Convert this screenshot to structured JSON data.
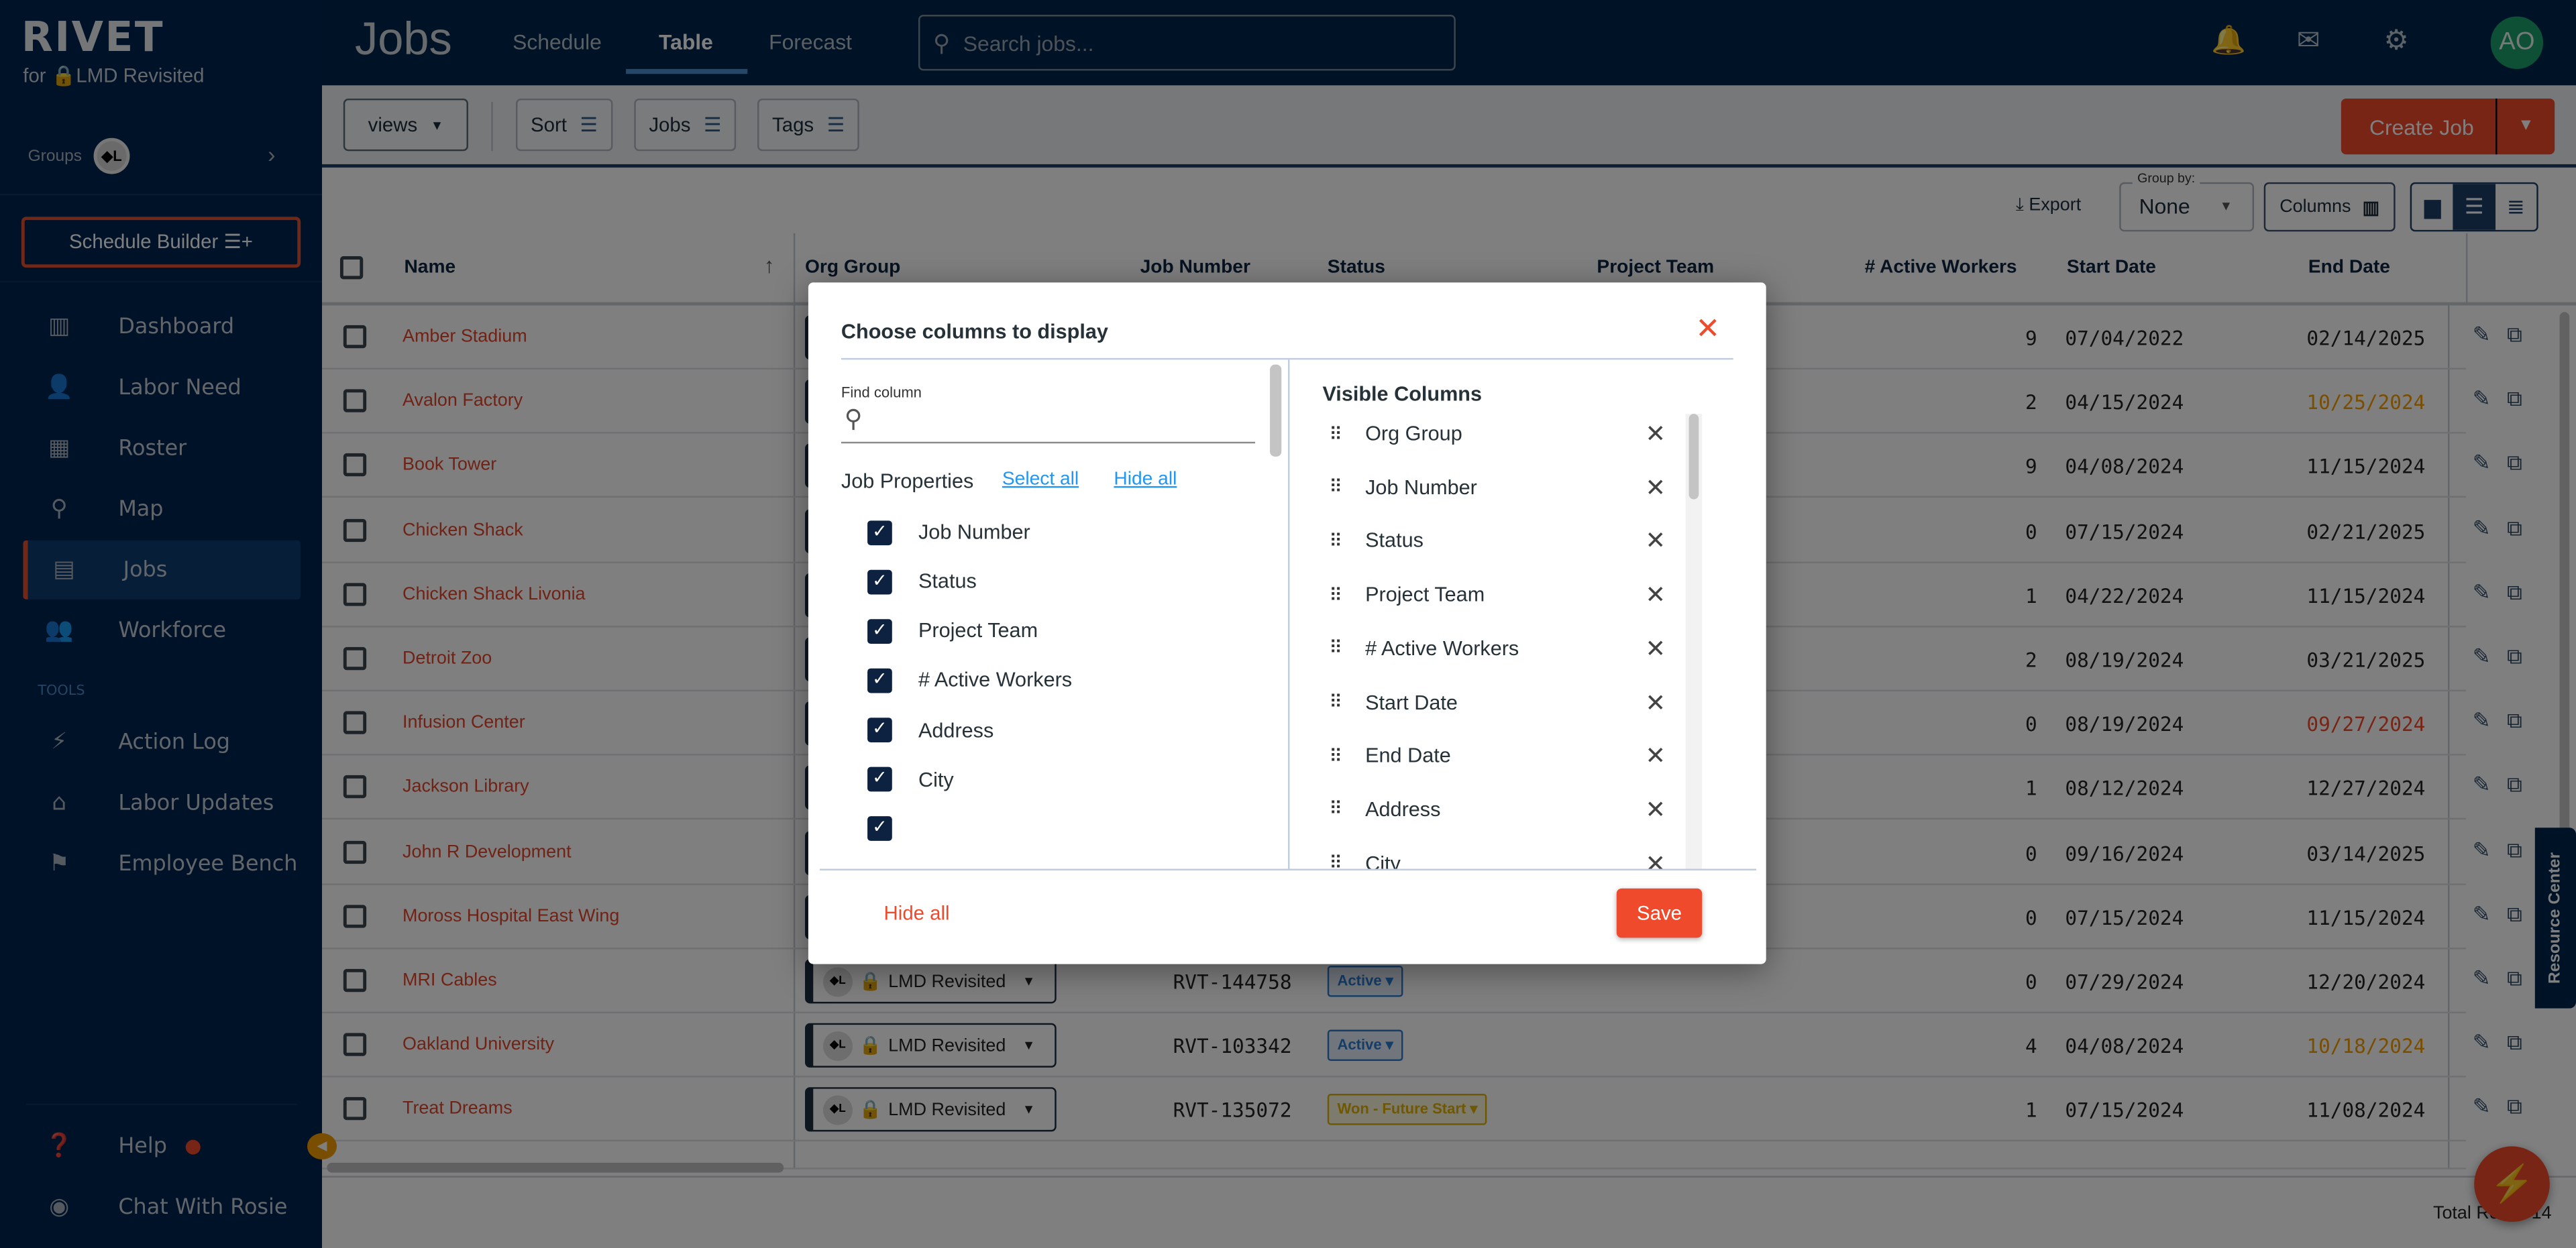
{
  "app": {
    "logo": "RIVET",
    "org_prefix": "for",
    "org_name": "LMD Revisited"
  },
  "sidebar": {
    "groups_label": "Groups",
    "group_avatar": "◆L",
    "schedule_builder": "Schedule Builder",
    "items": [
      {
        "label": "Dashboard",
        "icon": "bar-chart-icon",
        "glyph": "▥"
      },
      {
        "label": "Labor Need",
        "icon": "person-add-icon",
        "glyph": "👤"
      },
      {
        "label": "Roster",
        "icon": "table-icon",
        "glyph": "▦"
      },
      {
        "label": "Map",
        "icon": "map-pin-icon",
        "glyph": "⚲"
      },
      {
        "label": "Jobs",
        "icon": "building-icon",
        "glyph": "▤",
        "active": true
      },
      {
        "label": "Workforce",
        "icon": "people-icon",
        "glyph": "👥"
      }
    ],
    "tools_label": "TOOLS",
    "tools": [
      {
        "label": "Action Log",
        "icon": "lightning-icon",
        "glyph": "⚡"
      },
      {
        "label": "Labor Updates",
        "icon": "broadcast-icon",
        "glyph": "⌂"
      },
      {
        "label": "Employee Bench",
        "icon": "flag-icon",
        "glyph": "⚑"
      }
    ],
    "help": "Help",
    "chat": "Chat With Rosie"
  },
  "header": {
    "title": "Jobs",
    "tabs": [
      {
        "label": "Schedule"
      },
      {
        "label": "Table",
        "active": true
      },
      {
        "label": "Forecast"
      }
    ],
    "search_placeholder": "Search jobs...",
    "avatar": "AO"
  },
  "toolbar": {
    "views": "views",
    "sort": "Sort",
    "jobs": "Jobs",
    "tags": "Tags",
    "create_job": "Create Job",
    "export": "Export",
    "group_by_label": "Group by:",
    "group_by_value": "None",
    "columns": "Columns",
    "density_selected": "standard"
  },
  "table": {
    "headers": {
      "name": "Name",
      "org_group": "Org Group",
      "job_number": "Job Number",
      "status": "Status",
      "project_team": "Project Team",
      "active_workers": "# Active Workers",
      "start_date": "Start Date",
      "end_date": "End Date"
    },
    "sort": "name-ascending",
    "rows": [
      {
        "name": "Amber Stadium",
        "workers": "9",
        "start": "07/04/2022",
        "end": "02/14/2025"
      },
      {
        "name": "Avalon Factory",
        "workers": "2",
        "start": "04/15/2024",
        "end": "10/25/2024",
        "end_color": "#f59d00"
      },
      {
        "name": "Book Tower",
        "workers": "9",
        "start": "04/08/2024",
        "end": "11/15/2024"
      },
      {
        "name": "Chicken Shack",
        "workers": "0",
        "start": "07/15/2024",
        "end": "02/21/2025"
      },
      {
        "name": "Chicken Shack Livonia",
        "workers": "1",
        "start": "04/22/2024",
        "end": "11/15/2024"
      },
      {
        "name": "Detroit Zoo",
        "workers": "2",
        "start": "08/19/2024",
        "end": "03/21/2025"
      },
      {
        "name": "Infusion Center",
        "workers": "0",
        "start": "08/19/2024",
        "end": "09/27/2024",
        "end_color": "#f04a2c"
      },
      {
        "name": "Jackson Library",
        "workers": "1",
        "start": "08/12/2024",
        "end": "12/27/2024"
      },
      {
        "name": "John R Development",
        "workers": "0",
        "start": "09/16/2024",
        "end": "03/14/2025"
      },
      {
        "name": "Moross Hospital East Wing",
        "workers": "0",
        "start": "07/15/2024",
        "end": "11/15/2024"
      },
      {
        "name": "MRI Cables",
        "org": "LMD Revisited",
        "job": "RVT-144758",
        "status": "Active",
        "status_color": "#2a7ad0",
        "workers": "0",
        "start": "07/29/2024",
        "end": "12/20/2024"
      },
      {
        "name": "Oakland University",
        "org": "LMD Revisited",
        "job": "RVT-103342",
        "status": "Active",
        "status_color": "#2a7ad0",
        "workers": "4",
        "start": "04/08/2024",
        "end": "10/18/2024",
        "end_color": "#f59d00"
      },
      {
        "name": "Treat Dreams",
        "org": "LMD Revisited",
        "job": "RVT-135072",
        "status": "Won - Future Start",
        "status_color": "#e0b000",
        "workers": "1",
        "start": "07/15/2024",
        "end": "11/08/2024"
      }
    ],
    "total_rows": "Total Rows: 14"
  },
  "resource_center": "Resource Center",
  "modal": {
    "title": "Choose columns to display",
    "find_label": "Find column",
    "find_value": "",
    "section": "Job Properties",
    "select_all": "Select all",
    "hide_all_link": "Hide all",
    "checkboxes": [
      {
        "label": "Org Group",
        "checked": true
      },
      {
        "label": "Job Number",
        "checked": true
      },
      {
        "label": "Status",
        "checked": true
      },
      {
        "label": "Project Team",
        "checked": true
      },
      {
        "label": "# Active Workers",
        "checked": true
      },
      {
        "label": "Address",
        "checked": true
      },
      {
        "label": "City",
        "checked": true
      },
      {
        "label": "",
        "checked": true
      }
    ],
    "visible_title": "Visible Columns",
    "visible": [
      "Org Group",
      "Job Number",
      "Status",
      "Project Team",
      "# Active Workers",
      "Start Date",
      "End Date",
      "Address",
      "City"
    ],
    "hide_all": "Hide all",
    "save": "Save"
  },
  "colors": {
    "accent": "#f04a2c",
    "nav": "#00264d",
    "link": "#2196f3",
    "checkbox": "#0d2240"
  }
}
